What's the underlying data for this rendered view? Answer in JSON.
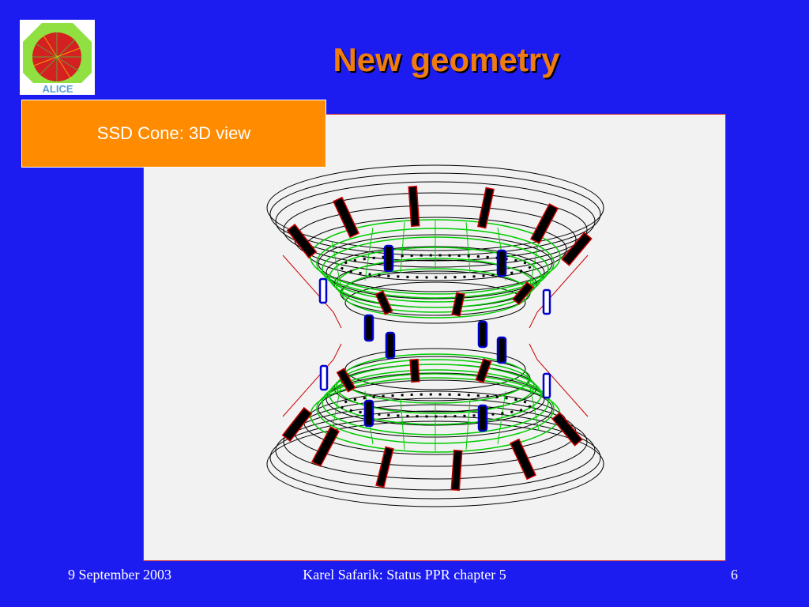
{
  "slide": {
    "title": "New geometry",
    "caption": "SSD Cone: 3D view",
    "footer": {
      "date": "9 September 2003",
      "center": "Karel Safarik: Status PPR chapter 5",
      "page": "6"
    }
  },
  "logo": {
    "text": "ALICE"
  },
  "colors": {
    "background": "#1c1cf0",
    "title": "#f07c10",
    "caption_box": "#ff8c00",
    "cone_outer": "#000000",
    "cone_inner": "#00cc00",
    "ladder_red": "#cc0000",
    "ladder_blue": "#0000cc"
  }
}
